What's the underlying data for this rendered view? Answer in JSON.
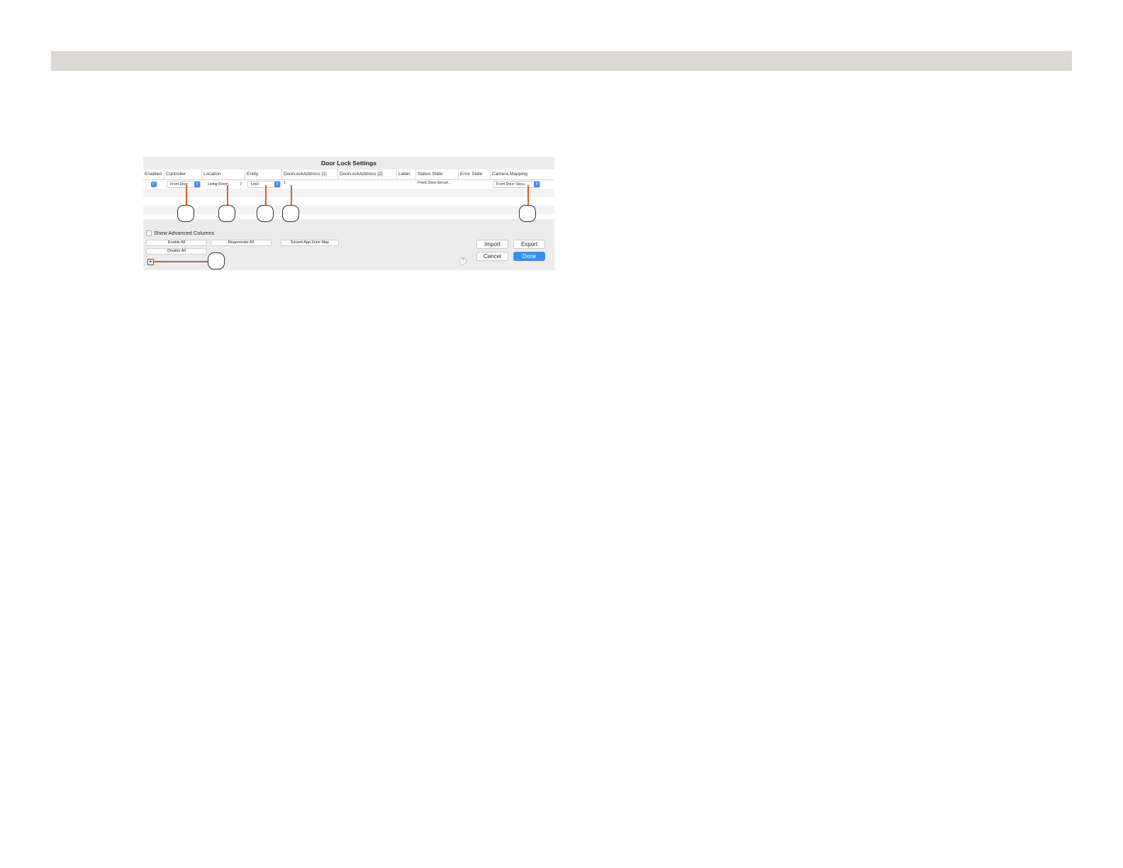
{
  "dialog": {
    "title": "Door Lock Settings",
    "columns": [
      "Enabled",
      "Controller",
      "Location",
      "Entity",
      "DoorLockAddress [1]",
      "DoorLockAddress [2]",
      "Label",
      "Status State",
      "Error State",
      "Camera Mapping"
    ],
    "row": {
      "enabled": "✓",
      "controller": "Front Door",
      "location": "Living Room",
      "entity": "Lock",
      "address1": "1",
      "status_state": "Front Door.Securi...",
      "camera_mapping": "Front Door~Secu..."
    },
    "show_advanced_label": "Show Advanced Columns",
    "enable_all_label": "Enable All",
    "disable_all_label": "Disable All",
    "regenerate_all_label": "Regenerate All",
    "zone_map_label": "Savant App Zone Map",
    "import_label": "Import",
    "export_label": "Export",
    "cancel_label": "Cancel",
    "done_label": "Done",
    "help_glyph": "?",
    "add_glyph": "+"
  },
  "colors": {
    "accent": "#3d8ff5",
    "callout_line": "#e05a1e",
    "top_bar": "#dcd9d5"
  },
  "icons": [
    "checkbox-checked-icon",
    "popup-arrow-icon",
    "stepper-icon",
    "help-icon",
    "plus-icon",
    "minus-icon"
  ]
}
